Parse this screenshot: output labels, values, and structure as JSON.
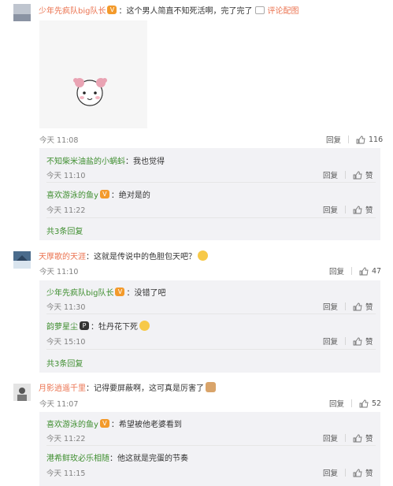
{
  "c1": {
    "user": "少年先疯队big队长",
    "text": "：这个男人简直不知死活啊，完了完了",
    "link": "评论配图",
    "time": "今天 11:08",
    "reply": "回复",
    "likes": "116",
    "subs": [
      {
        "user": "不知柴米油盐的小蜗蚪",
        "text": "：我也觉得",
        "time": "今天 11:10",
        "reply": "回复",
        "like": "赞"
      },
      {
        "user": "喜欢游泳的鱼y",
        "text": "：绝对是的",
        "time": "今天 11:22",
        "reply": "回复",
        "like": "赞"
      }
    ],
    "more": "共3条回复"
  },
  "c2": {
    "user": "天厚歌的天涯",
    "text": "：这就是传说中的色胆包天吧？",
    "time": "今天 11:10",
    "reply": "回复",
    "likes": "47",
    "subs": [
      {
        "user": "少年先疯队big队长",
        "text": "：没错了吧",
        "time": "今天 11:30",
        "reply": "回复",
        "like": "赞"
      },
      {
        "user": "韵萝星尘",
        "text": "：牡丹花下死",
        "time": "今天 15:10",
        "reply": "回复",
        "like": "赞"
      }
    ],
    "more": "共3条回复"
  },
  "c3": {
    "user": "月影逍遥千里",
    "text": "：记得要屏蔽啊，这可真是厉害了",
    "time": "今天 11:07",
    "reply": "回复",
    "likes": "52",
    "subs": [
      {
        "user": "喜欢游泳的鱼y",
        "text": "：希望被他老婆看到",
        "time": "今天 11:22",
        "reply": "回复",
        "like": "赞"
      },
      {
        "user": "港希鲜玫必乐相随",
        "text": "：他这就是完蛋的节奏",
        "time": "今天 11:15",
        "reply": "回复",
        "like": "赞"
      }
    ]
  }
}
